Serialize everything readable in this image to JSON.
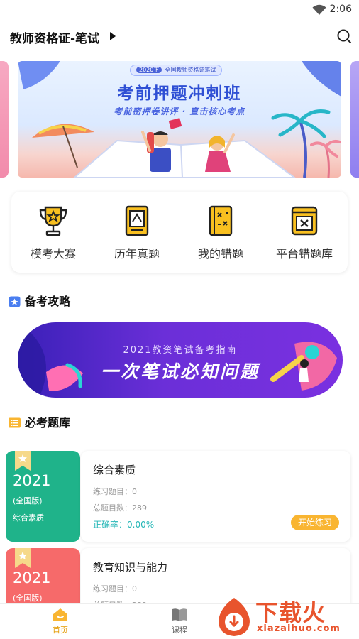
{
  "status": {
    "time": "2:06"
  },
  "header": {
    "title": "教师资格证-笔试"
  },
  "banner": {
    "pill_year": "2020下",
    "pill_text": "全国教师资格证笔试",
    "headline": "考前押题冲刺班",
    "subline": "考前密押卷讲评 · 直击核心考点"
  },
  "tools": [
    {
      "label": "模考大赛",
      "icon": "trophy-icon"
    },
    {
      "label": "历年真题",
      "icon": "exam-paper-icon"
    },
    {
      "label": "我的错题",
      "icon": "wrong-notebook-icon"
    },
    {
      "label": "平台错题库",
      "icon": "error-bank-icon"
    }
  ],
  "sections": {
    "strategy": "备考攻略",
    "bank": "必考题库"
  },
  "promo": {
    "top_text": "2021教资笔试备考指南",
    "main_text": "一次笔试必知问题"
  },
  "banks": [
    {
      "year": "2021",
      "edition": "(全国版)",
      "cover_name": "综合素质",
      "name": "综合素质",
      "practice_label": "练习题目：0",
      "total_label": "总题目数：289",
      "accuracy_label": "正确率：0.00%",
      "button": "开始练习",
      "color": "#1fb38a"
    },
    {
      "year": "2021",
      "edition": "(全国版)",
      "name": "教育知识与能力",
      "practice_label": "练习题目：0",
      "total_label": "总题目数：289",
      "color": "#f66a6a"
    }
  ],
  "nav": [
    {
      "label": "首页",
      "icon": "home-icon",
      "active": true
    },
    {
      "label": "课程",
      "icon": "book-icon",
      "active": false
    }
  ],
  "watermark": {
    "main": "下载火",
    "sub": "xiazaihuo.com"
  },
  "colors": {
    "accent": "#f9b531",
    "primary_blue": "#2e4fd4",
    "teal": "#23b6b6",
    "brand_orange": "#e8542d"
  }
}
